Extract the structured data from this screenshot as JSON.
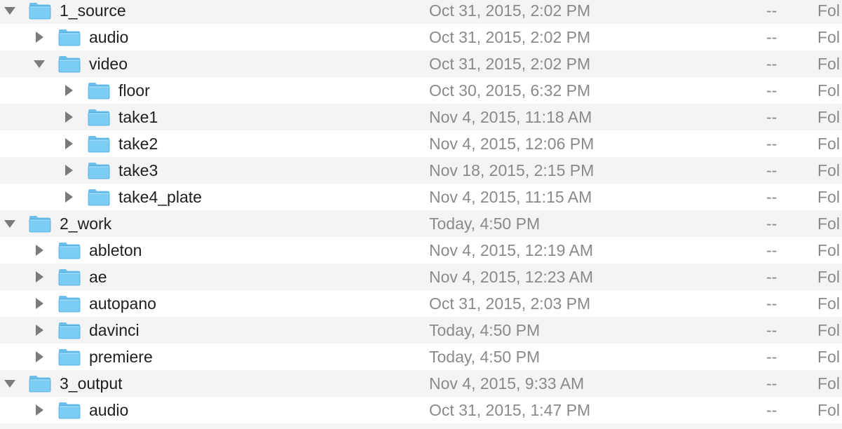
{
  "accent_colors": {
    "folder_fill": "#7ccdf3",
    "folder_tab": "#6cbfe9",
    "folder_edge": "#4aa8dd"
  },
  "rows": [
    {
      "name": "1_source",
      "date": "Oct 31, 2015, 2:02 PM",
      "size": "--",
      "kind": "Fol",
      "expanded": true
    },
    {
      "name": "audio",
      "date": "Oct 31, 2015, 2:02 PM",
      "size": "--",
      "kind": "Fol",
      "expanded": false
    },
    {
      "name": "video",
      "date": "Oct 31, 2015, 2:02 PM",
      "size": "--",
      "kind": "Fol",
      "expanded": true
    },
    {
      "name": "floor",
      "date": "Oct 30, 2015, 6:32 PM",
      "size": "--",
      "kind": "Fol",
      "expanded": false
    },
    {
      "name": "take1",
      "date": "Nov 4, 2015, 11:18 AM",
      "size": "--",
      "kind": "Fol",
      "expanded": false
    },
    {
      "name": "take2",
      "date": "Nov 4, 2015, 12:06 PM",
      "size": "--",
      "kind": "Fol",
      "expanded": false
    },
    {
      "name": "take3",
      "date": "Nov 18, 2015, 2:15 PM",
      "size": "--",
      "kind": "Fol",
      "expanded": false
    },
    {
      "name": "take4_plate",
      "date": "Nov 4, 2015, 11:15 AM",
      "size": "--",
      "kind": "Fol",
      "expanded": false
    },
    {
      "name": "2_work",
      "date": "Today, 4:50 PM",
      "size": "--",
      "kind": "Fol",
      "expanded": true
    },
    {
      "name": "ableton",
      "date": "Nov 4, 2015, 12:19 AM",
      "size": "--",
      "kind": "Fol",
      "expanded": false
    },
    {
      "name": "ae",
      "date": "Nov 4, 2015, 12:23 AM",
      "size": "--",
      "kind": "Fol",
      "expanded": false
    },
    {
      "name": "autopano",
      "date": "Oct 31, 2015, 2:03 PM",
      "size": "--",
      "kind": "Fol",
      "expanded": false
    },
    {
      "name": "davinci",
      "date": "Today, 4:50 PM",
      "size": "--",
      "kind": "Fol",
      "expanded": false
    },
    {
      "name": "premiere",
      "date": "Today, 4:50 PM",
      "size": "--",
      "kind": "Fol",
      "expanded": false
    },
    {
      "name": "3_output",
      "date": "Nov 4, 2015, 9:33 AM",
      "size": "--",
      "kind": "Fol",
      "expanded": true
    },
    {
      "name": "audio",
      "date": "Oct 31, 2015, 1:47 PM",
      "size": "--",
      "kind": "Fol",
      "expanded": false
    },
    {
      "name": "",
      "date": "",
      "size": "",
      "kind": "",
      "expanded": false
    }
  ]
}
